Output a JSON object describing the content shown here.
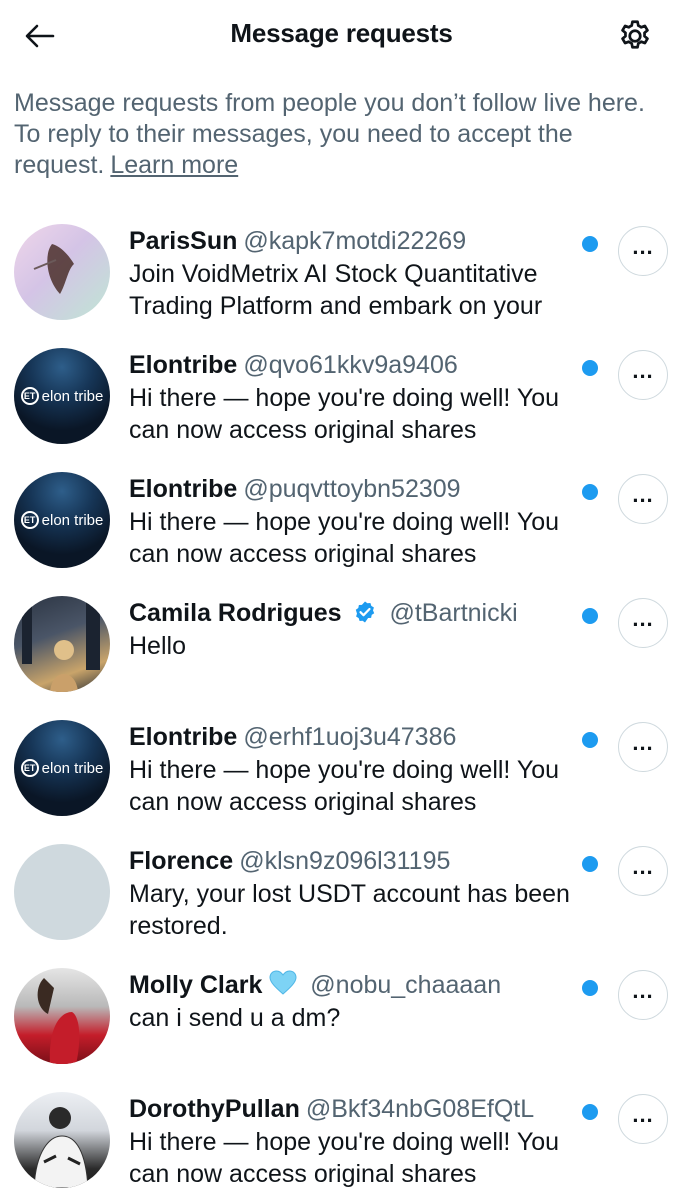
{
  "header": {
    "title": "Message requests",
    "back_icon": "arrow-left-icon",
    "settings_icon": "gear-icon"
  },
  "info": {
    "text": "Message requests from people you don’t follow live here. To reply to their messages, you need to accept the request.",
    "learn_more": "Learn more"
  },
  "colors": {
    "unread_dot": "#1d9bf0",
    "secondary_text": "#536471",
    "verified": "#1d9bf0",
    "heart": "#7dd3f5"
  },
  "requests": [
    {
      "name": "ParisSun",
      "handle": "@kapk7motdi22269",
      "message": "Join VoidMetrix AI Stock Quantitative Trading Platform and embark on your"
    },
    {
      "name": "Elontribe",
      "handle": "@qvo61kkv9a9406",
      "message": "Hi there — hope you're doing well! You can now access original shares",
      "avatar_text": "elon tribe"
    },
    {
      "name": "Elontribe",
      "handle": "@puqvttoybn52309",
      "message": "Hi there — hope you're doing well! You can now access original shares",
      "avatar_text": "elon tribe"
    },
    {
      "name": "Camila Rodrigues",
      "handle": "@tBartnicki",
      "message": "Hello",
      "verified": true
    },
    {
      "name": "Elontribe",
      "handle": "@erhf1uoj3u47386",
      "message": "Hi there — hope you're doing well! You can now access original shares",
      "avatar_text": "elon tribe"
    },
    {
      "name": "Florence",
      "handle": "@klsn9z096l31195",
      "message": "Mary, your lost USDT account has been restored."
    },
    {
      "name": "Molly Clark",
      "handle": "@nobu_chaaaan",
      "message": "can i send u a dm?",
      "name_emoji": "blue-heart-icon"
    },
    {
      "name": "DorothyPullan",
      "handle": "@Bkf34nbG08EfQtL",
      "message": "Hi there — hope you're doing well! You can now access original shares"
    }
  ]
}
